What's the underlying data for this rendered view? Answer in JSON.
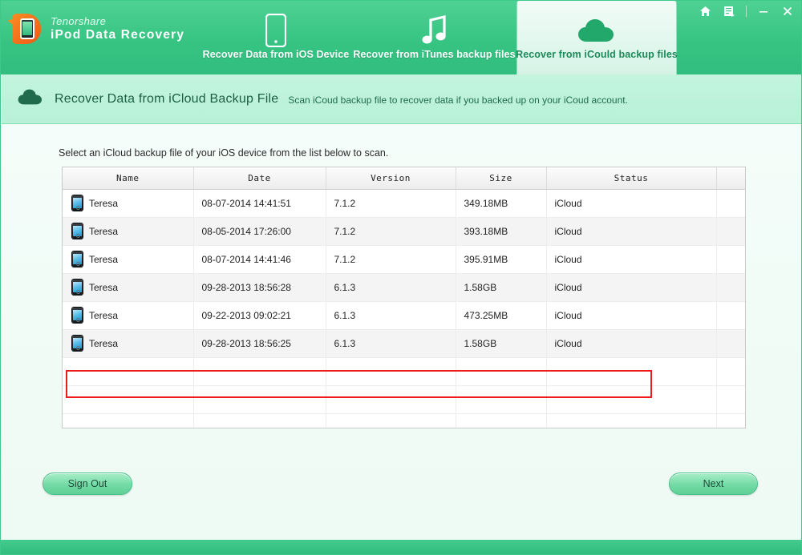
{
  "brand": {
    "company": "Tenorshare",
    "product": "iPod Data Recovery",
    "logo_icon": "tenorshare-d-logo-icon"
  },
  "tabs": [
    {
      "id": "ios",
      "label": "Recover Data from iOS Device",
      "icon": "iphone-icon",
      "active": false
    },
    {
      "id": "itunes",
      "label": "Recover from iTunes backup files",
      "icon": "music-note-icon",
      "active": false
    },
    {
      "id": "icloud",
      "label": "Recover from iCould backup files",
      "icon": "cloud-icon",
      "active": true
    }
  ],
  "window_controls": [
    {
      "id": "home",
      "icon": "home-icon",
      "glyph": "⌂"
    },
    {
      "id": "feedback",
      "icon": "document-list-icon",
      "glyph": "☰"
    },
    {
      "id": "minimize",
      "icon": "minimize-icon",
      "glyph": "–"
    },
    {
      "id": "close",
      "icon": "close-icon",
      "glyph": "✕"
    }
  ],
  "subheader": {
    "icon": "cloud-icon",
    "title": "Recover Data from iCloud Backup File",
    "subtitle": "Scan iCoud backup file to recover data if you backed up on your iCoud account."
  },
  "content": {
    "hint": "Select an iCloud backup file of your iOS device from the list below to scan."
  },
  "table": {
    "columns": [
      "Name",
      "Date",
      "Version",
      "Size",
      "Status"
    ],
    "rows": [
      {
        "name": "Teresa",
        "date": "08-07-2014 14:41:51",
        "version": "7.1.2",
        "size": "349.18MB",
        "status": "iCloud",
        "selected": false
      },
      {
        "name": "Teresa",
        "date": "08-05-2014 17:26:00",
        "version": "7.1.2",
        "size": "393.18MB",
        "status": "iCloud",
        "selected": false
      },
      {
        "name": "Teresa",
        "date": "08-07-2014 14:41:46",
        "version": "7.1.2",
        "size": "395.91MB",
        "status": "iCloud",
        "selected": true
      },
      {
        "name": "Teresa",
        "date": "09-28-2013 18:56:28",
        "version": "6.1.3",
        "size": "1.58GB",
        "status": "iCloud",
        "selected": false
      },
      {
        "name": "Teresa",
        "date": "09-22-2013 09:02:21",
        "version": "6.1.3",
        "size": "473.25MB",
        "status": "iCloud",
        "selected": false
      },
      {
        "name": "Teresa",
        "date": "09-28-2013 18:56:25",
        "version": "6.1.3",
        "size": "1.58GB",
        "status": "iCloud",
        "selected": false
      }
    ],
    "empty_row_count": 3
  },
  "buttons": {
    "sign_out": "Sign Out",
    "next": "Next"
  },
  "colors": {
    "brand_green": "#37c483",
    "subheader_green": "#bdf2da",
    "highlight_red": "#ee1b1b",
    "button_green": "#76dba7",
    "active_tab_text": "#1d8a5a"
  }
}
